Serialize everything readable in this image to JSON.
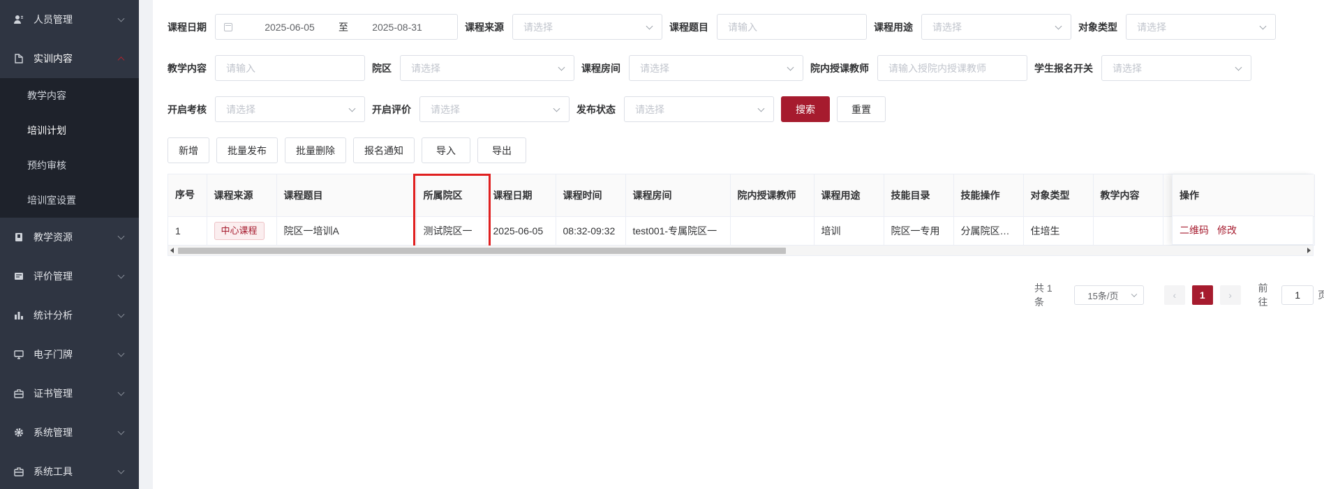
{
  "sidebar": {
    "items": [
      {
        "label": "人员管理",
        "icon": "user-icon"
      },
      {
        "label": "实训内容",
        "icon": "content-icon",
        "active": true,
        "children": [
          {
            "label": "教学内容"
          },
          {
            "label": "培训计划",
            "active": true
          },
          {
            "label": "预约审核"
          },
          {
            "label": "培训室设置"
          }
        ]
      },
      {
        "label": "教学资源",
        "icon": "book-icon"
      },
      {
        "label": "评价管理",
        "icon": "rating-icon"
      },
      {
        "label": "统计分析",
        "icon": "chart-icon"
      },
      {
        "label": "电子门牌",
        "icon": "monitor-icon"
      },
      {
        "label": "证书管理",
        "icon": "certificate-icon"
      },
      {
        "label": "系统管理",
        "icon": "gear-icon"
      },
      {
        "label": "系统工具",
        "icon": "toolbox-icon"
      }
    ]
  },
  "filters": {
    "course_date": {
      "label": "课程日期",
      "start": "2025-06-05",
      "sep": "至",
      "end": "2025-08-31"
    },
    "course_source": {
      "label": "课程来源",
      "placeholder": "请选择"
    },
    "course_title": {
      "label": "课程题目",
      "placeholder": "请输入"
    },
    "course_usage": {
      "label": "课程用途",
      "placeholder": "请选择"
    },
    "target_type": {
      "label": "对象类型",
      "placeholder": "请选择"
    },
    "teaching_content": {
      "label": "教学内容",
      "placeholder": "请输入"
    },
    "campus": {
      "label": "院区",
      "placeholder": "请选择"
    },
    "room": {
      "label": "课程房间",
      "placeholder": "请选择"
    },
    "teacher": {
      "label": "院内授课教师",
      "placeholder": "请输入授院内授课教师"
    },
    "signup": {
      "label": "学生报名开关",
      "placeholder": "请选择"
    },
    "exam": {
      "label": "开启考核",
      "placeholder": "请选择"
    },
    "evaluation": {
      "label": "开启评价",
      "placeholder": "请选择"
    },
    "publish": {
      "label": "发布状态",
      "placeholder": "请选择"
    },
    "search_label": "搜索",
    "reset_label": "重置"
  },
  "toolbar": {
    "add": "新增",
    "batch_publish": "批量发布",
    "batch_delete": "批量删除",
    "signup_notice": "报名通知",
    "import": "导入",
    "export": "导出"
  },
  "table": {
    "headers": [
      "序号",
      "课程来源",
      "课程题目",
      "所属院区",
      "课程日期",
      "课程时间",
      "课程房间",
      "院内授课教师",
      "课程用途",
      "技能目录",
      "技能操作",
      "对象类型",
      "教学内容"
    ],
    "op_header": "操作",
    "rows": [
      {
        "index": "1",
        "source": "中心课程",
        "title": "院区一培训A",
        "campus": "测试院区一",
        "date": "2025-06-05",
        "time": "08:32-09:32",
        "room": "test001-专属院区一",
        "teacher": "",
        "usage": "培训",
        "skill_dir": "院区一专用",
        "skill_op": "分属院区一操作",
        "target": "住培生",
        "content": "",
        "ops": [
          "二维码",
          "修改"
        ]
      }
    ]
  },
  "pagination": {
    "total": "共 1 条",
    "page_size": "15条/页",
    "current": "1",
    "goto_prefix": "前往",
    "goto_value": "1",
    "goto_suffix": "页"
  },
  "colors": {
    "accent": "#a61b2e",
    "sidebar": "#2f3542",
    "highlight": "#e02020"
  }
}
